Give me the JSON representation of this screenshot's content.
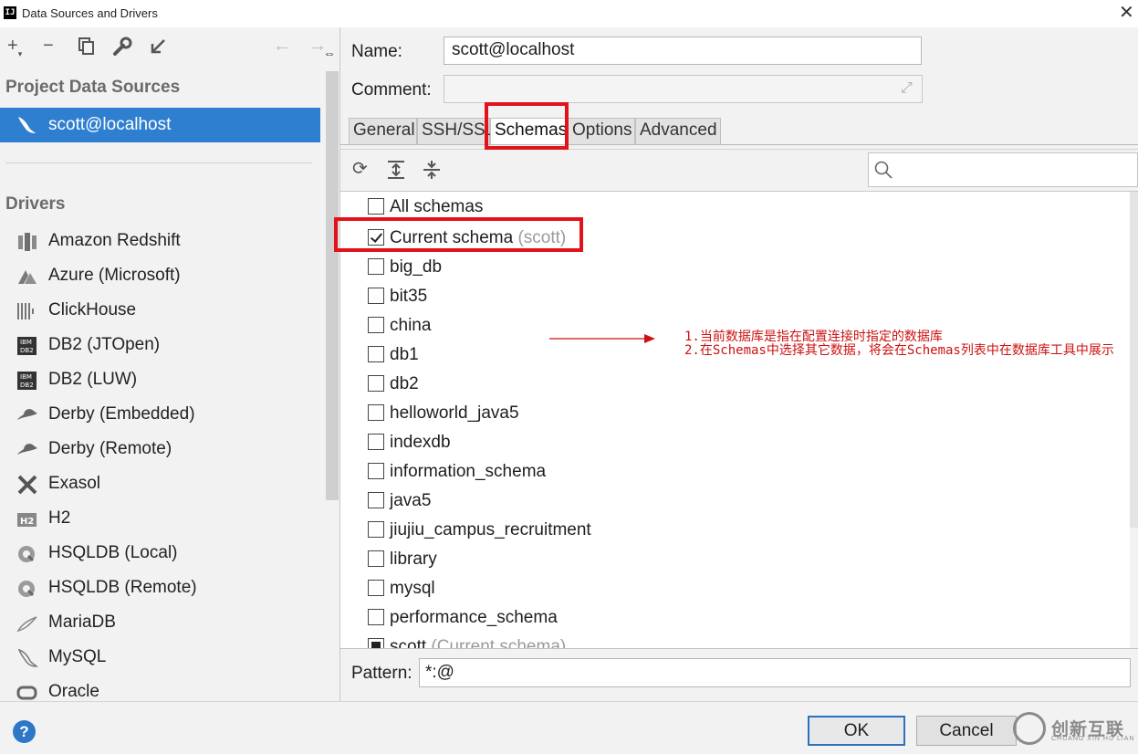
{
  "window": {
    "title": "Data Sources and Drivers",
    "app_icon_text": "IJ"
  },
  "left_panel": {
    "toolbar": [
      "add",
      "remove",
      "duplicate",
      "settings",
      "import",
      "back",
      "forward"
    ],
    "project_header": "Project Data Sources",
    "data_sources": [
      {
        "label": "scott@localhost",
        "icon": "mysql-dolphin-icon"
      }
    ],
    "drivers_header": "Drivers",
    "drivers": [
      {
        "label": "Amazon Redshift",
        "icon": "redshift-icon"
      },
      {
        "label": "Azure (Microsoft)",
        "icon": "azure-icon"
      },
      {
        "label": "ClickHouse",
        "icon": "clickhouse-icon"
      },
      {
        "label": "DB2 (JTOpen)",
        "icon": "db2-icon"
      },
      {
        "label": "DB2 (LUW)",
        "icon": "db2-icon"
      },
      {
        "label": "Derby (Embedded)",
        "icon": "derby-hat-icon"
      },
      {
        "label": "Derby (Remote)",
        "icon": "derby-hat-icon"
      },
      {
        "label": "Exasol",
        "icon": "exasol-icon"
      },
      {
        "label": "H2",
        "icon": "h2-icon"
      },
      {
        "label": "HSQLDB (Local)",
        "icon": "hsqldb-icon"
      },
      {
        "label": "HSQLDB (Remote)",
        "icon": "hsqldb-icon"
      },
      {
        "label": "MariaDB",
        "icon": "mariadb-icon"
      },
      {
        "label": "MySQL",
        "icon": "mysql-icon"
      },
      {
        "label": "Oracle",
        "icon": "oracle-icon"
      }
    ]
  },
  "form": {
    "name_label": "Name:",
    "name_value": "scott@localhost",
    "comment_label": "Comment:",
    "comment_value": ""
  },
  "tabs": [
    {
      "label": "General",
      "active": false
    },
    {
      "label": "SSH/SSL",
      "active": false
    },
    {
      "label": "Schemas",
      "active": true
    },
    {
      "label": "Options",
      "active": false
    },
    {
      "label": "Advanced",
      "active": false
    }
  ],
  "schemas": {
    "search_value": "",
    "items": [
      {
        "label": "All schemas",
        "hint": "",
        "state": "unchecked"
      },
      {
        "label": "Current schema",
        "hint": "(scott)",
        "state": "checked"
      },
      {
        "label": "big_db",
        "hint": "",
        "state": "unchecked"
      },
      {
        "label": "bit35",
        "hint": "",
        "state": "unchecked"
      },
      {
        "label": "china",
        "hint": "",
        "state": "unchecked"
      },
      {
        "label": "db1",
        "hint": "",
        "state": "unchecked"
      },
      {
        "label": "db2",
        "hint": "",
        "state": "unchecked"
      },
      {
        "label": "helloworld_java5",
        "hint": "",
        "state": "unchecked"
      },
      {
        "label": "indexdb",
        "hint": "",
        "state": "unchecked"
      },
      {
        "label": "information_schema",
        "hint": "",
        "state": "unchecked"
      },
      {
        "label": "java5",
        "hint": "",
        "state": "unchecked"
      },
      {
        "label": "jiujiu_campus_recruitment",
        "hint": "",
        "state": "unchecked"
      },
      {
        "label": "library",
        "hint": "",
        "state": "unchecked"
      },
      {
        "label": "mysql",
        "hint": "",
        "state": "unchecked"
      },
      {
        "label": "performance_schema",
        "hint": "",
        "state": "unchecked"
      },
      {
        "label": "scott",
        "hint": "(Current schema)",
        "state": "filled"
      }
    ]
  },
  "annotation": {
    "line1": "1.当前数据库是指在配置连接时指定的数据库",
    "line2": "2.在Schemas中选择其它数据，将会在Schemas列表中在数据库工具中展示",
    "color": "#cc1111"
  },
  "pattern": {
    "label": "Pattern:",
    "value": "*:@"
  },
  "buttons": {
    "help": "?",
    "ok": "OK",
    "cancel": "Cancel"
  },
  "watermark": {
    "text": "创新互联",
    "sub": "CHUANG XIN HU LIAN"
  },
  "colors": {
    "selection": "#2f7fd0",
    "highlight_box": "#e3121a",
    "ok_border": "#2e6fbf"
  }
}
